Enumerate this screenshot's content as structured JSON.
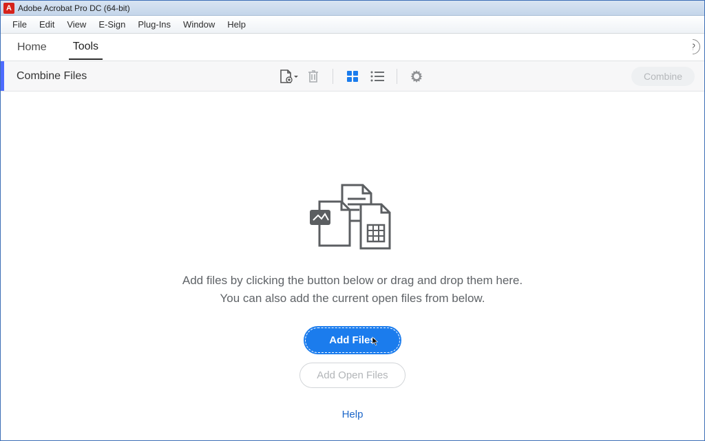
{
  "window": {
    "title": "Adobe Acrobat Pro DC (64-bit)"
  },
  "menu": {
    "file": "File",
    "edit": "Edit",
    "view": "View",
    "esign": "E-Sign",
    "plugins": "Plug-Ins",
    "window": "Window",
    "help": "Help"
  },
  "navtabs": {
    "home": "Home",
    "tools": "Tools"
  },
  "toolbar": {
    "title": "Combine Files",
    "combine_label": "Combine"
  },
  "main": {
    "instruction_line1": "Add files by clicking the button below or drag and drop them here.",
    "instruction_line2": "You can also add the current open files from below.",
    "add_files_label": "Add Files",
    "add_open_files_label": "Add Open Files",
    "help_link_label": "Help"
  }
}
